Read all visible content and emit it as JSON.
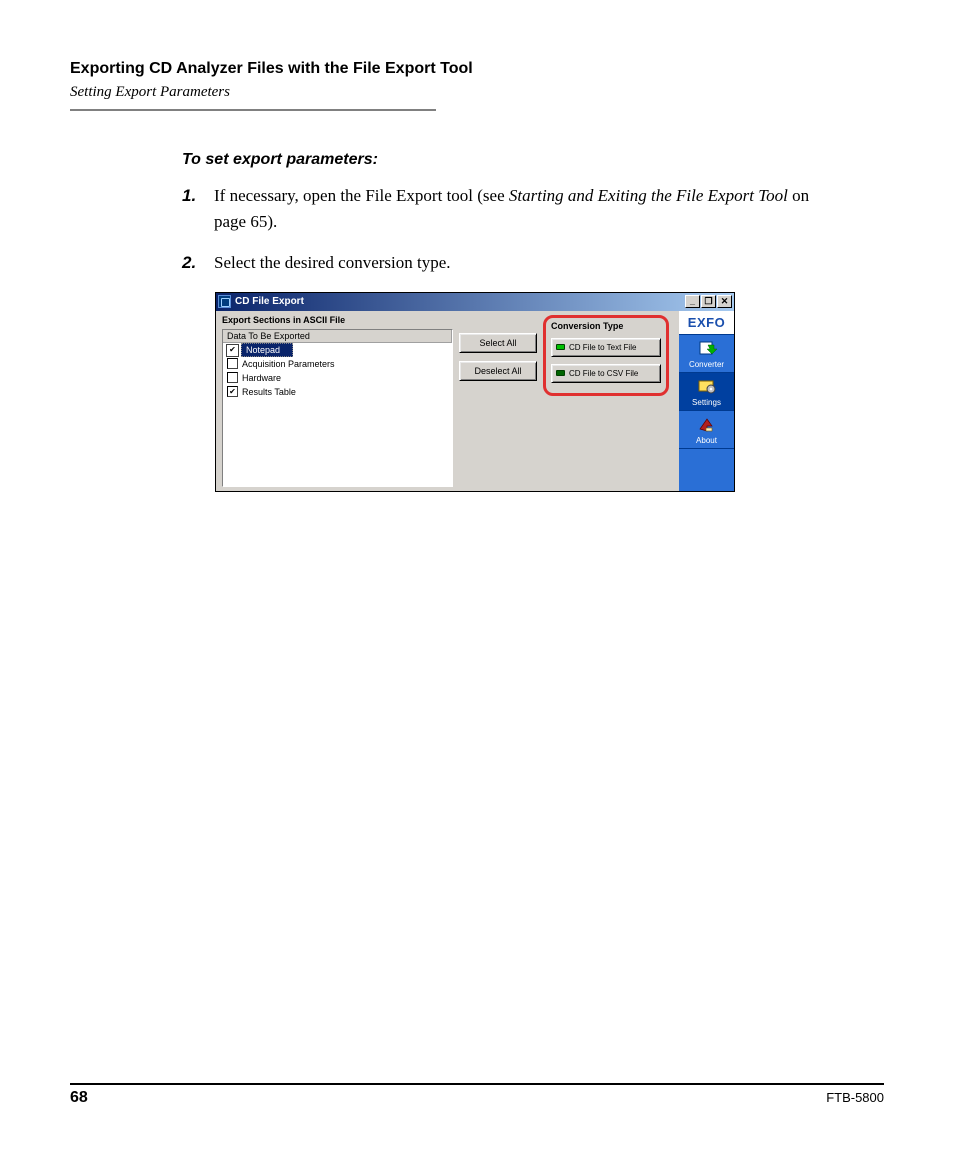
{
  "header": {
    "title": "Exporting CD Analyzer Files with the File Export Tool",
    "subtitle": "Setting Export Parameters"
  },
  "section_head": "To set export parameters:",
  "steps": [
    {
      "num": "1.",
      "pre": "If necessary, open the File Export tool (see ",
      "ital": "Starting and Exiting the File Export Tool",
      "post": " on page 65)."
    },
    {
      "num": "2.",
      "pre": "Select the desired conversion type.",
      "ital": "",
      "post": ""
    }
  ],
  "window": {
    "title": "CD File Export",
    "min": "_",
    "restore": "❐",
    "close": "✕",
    "export_group": "Export Sections in ASCII File",
    "list_header": "Data To Be Exported",
    "items": {
      "notepad": {
        "label": "Notepad",
        "checked": true,
        "selected": true
      },
      "acq": {
        "label": "Acquisition Parameters",
        "checked": false
      },
      "hw": {
        "label": "Hardware",
        "checked": false
      },
      "rt": {
        "label": "Results Table",
        "checked": true
      }
    },
    "btn_select_all": "Select All",
    "btn_deselect_all": "Deselect All",
    "conv_group": "Conversion Type",
    "conv_txt": "CD File to Text File",
    "conv_csv": "CD File to CSV File",
    "logo": "EXFO",
    "nav": {
      "converter": "Converter",
      "settings": "Settings",
      "about": "About"
    }
  },
  "footer": {
    "page": "68",
    "product": "FTB-5800"
  }
}
